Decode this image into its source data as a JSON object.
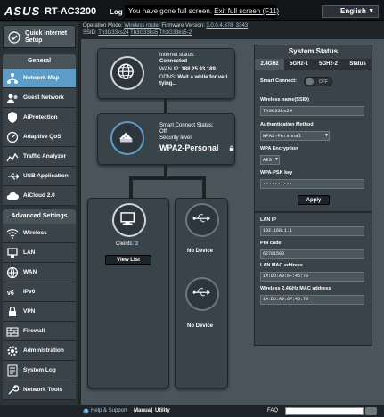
{
  "header": {
    "brand": "ASUS",
    "model": "RT-AC3200",
    "logout_label": "Log",
    "fullscreen_notice": "You have gone full screen.",
    "fullscreen_exit": "Exit full screen (F11)",
    "language": "English"
  },
  "infobar": {
    "opmode_label": "Operation Mode:",
    "opmode_value": "Wireless router",
    "firmware_label": "Firmware Version:",
    "firmware_value": "3.0.0.4.378_3343",
    "ssid_label": "SSID:",
    "ssid_values": [
      "Th3G33ks24",
      "Th3G33ks5",
      "Th3G33ks5-2"
    ]
  },
  "sidebar": {
    "qis_label_1": "Quick Internet",
    "qis_label_2": "Setup",
    "general_heading": "General",
    "general_items": [
      {
        "label": "Network Map",
        "icon": "network-map-icon",
        "active": true
      },
      {
        "label": "Guest Network",
        "icon": "guest-network-icon"
      },
      {
        "label": "AiProtection",
        "icon": "aiprotection-icon"
      },
      {
        "label": "Adaptive QoS",
        "icon": "qos-icon"
      },
      {
        "label": "Traffic Analyzer",
        "icon": "traffic-analyzer-icon"
      },
      {
        "label": "USB Application",
        "icon": "usb-icon"
      },
      {
        "label": "AiCloud 2.0",
        "icon": "cloud-icon"
      }
    ],
    "advanced_heading": "Advanced Settings",
    "advanced_items": [
      {
        "label": "Wireless",
        "icon": "wireless-icon"
      },
      {
        "label": "LAN",
        "icon": "lan-icon"
      },
      {
        "label": "WAN",
        "icon": "wan-icon"
      },
      {
        "label": "IPv6",
        "icon": "ipv6-icon"
      },
      {
        "label": "VPN",
        "icon": "vpn-icon"
      },
      {
        "label": "Firewall",
        "icon": "firewall-icon"
      },
      {
        "label": "Administration",
        "icon": "administration-icon"
      },
      {
        "label": "System Log",
        "icon": "system-log-icon"
      },
      {
        "label": "Network Tools",
        "icon": "network-tools-icon"
      }
    ]
  },
  "network_map": {
    "internet_status_label": "Internet status:",
    "internet_status_value": "Connected",
    "wan_ip_label": "WAN IP:",
    "wan_ip_value": "188.25.93.189",
    "ddns_label": "DDNS:",
    "ddns_value_1": "Wait a while for veri",
    "ddns_value_2": "tying...",
    "smart_connect_label": "Smart Connect Status:",
    "smart_connect_value": "Off",
    "security_label": "Security level:",
    "security_value": "WPA2-Personal",
    "clients_label": "Clients:",
    "clients_count": "3",
    "view_list_label": "View List",
    "usb1_tag": "USB 3.0",
    "usb1_status": "No Device",
    "usb2_tag": "USB 2.0",
    "usb2_status": "No Device"
  },
  "system_status": {
    "title": "System Status",
    "tabs": [
      "2.4GHz",
      "5GHz-1",
      "5GHz-2",
      "Status"
    ],
    "active_tab": "2.4GHz",
    "smart_connect_label": "Smart Connect:",
    "smart_connect_toggle": "OFF",
    "wireless_name_label": "Wireless name(SSID)",
    "wireless_name_value": "Th3G33ks24",
    "auth_method_label": "Authentication Method",
    "auth_method_value": "WPA2-Personal",
    "wpa_encryption_label": "WPA Encryption",
    "wpa_encryption_value": "AES",
    "wpa_psk_label": "WPA-PSK key",
    "wpa_psk_value": "••••••••••",
    "apply_label": "Apply",
    "lan_ip_label": "LAN IP",
    "lan_ip_value": "192.168.1.1",
    "pin_code_label": "PIN code",
    "pin_code_value": "62781503",
    "lan_mac_label": "LAN MAC address",
    "lan_mac_value": "14:DD:A9:6F:46:70",
    "wireless_mac_label": "Wireless 2.4GHz MAC address",
    "wireless_mac_value": "14:DD:A9:6F:46:70"
  },
  "footer": {
    "help_label": "Help & Support",
    "manual_label": "Manual",
    "separator": "|",
    "utility_label": "Utility",
    "faq_label": "FAQ"
  },
  "colors": {
    "active_nav": "#5b9cc8",
    "panel": "#3a4349",
    "accent_link": "#9ecbe4"
  }
}
